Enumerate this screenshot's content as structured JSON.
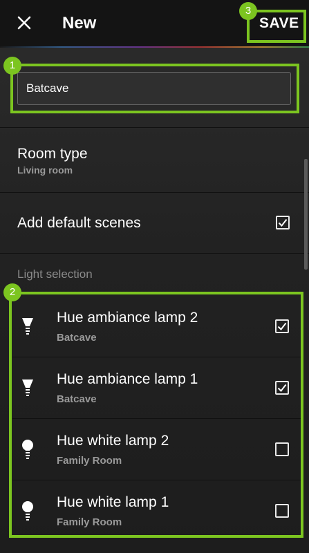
{
  "header": {
    "title": "New",
    "save_label": "SAVE"
  },
  "name_field": {
    "value": "Batcave"
  },
  "room_type": {
    "label": "Room type",
    "value": "Living room"
  },
  "default_scenes": {
    "label": "Add default scenes",
    "checked": true
  },
  "light_selection": {
    "label": "Light selection",
    "lamps": [
      {
        "name": "Hue ambiance lamp 2",
        "room": "Batcave",
        "checked": true
      },
      {
        "name": "Hue ambiance lamp 1",
        "room": "Batcave",
        "checked": true
      },
      {
        "name": "Hue white lamp 2",
        "room": "Family Room",
        "checked": false
      },
      {
        "name": "Hue white lamp 1",
        "room": "Family Room",
        "checked": false
      }
    ]
  },
  "annotations": {
    "badge_1": "1",
    "badge_2": "2",
    "badge_3": "3",
    "highlight_color": "#7cc520"
  },
  "icons": [
    "close-icon",
    "checkmark-icon",
    "bulb-icon"
  ]
}
